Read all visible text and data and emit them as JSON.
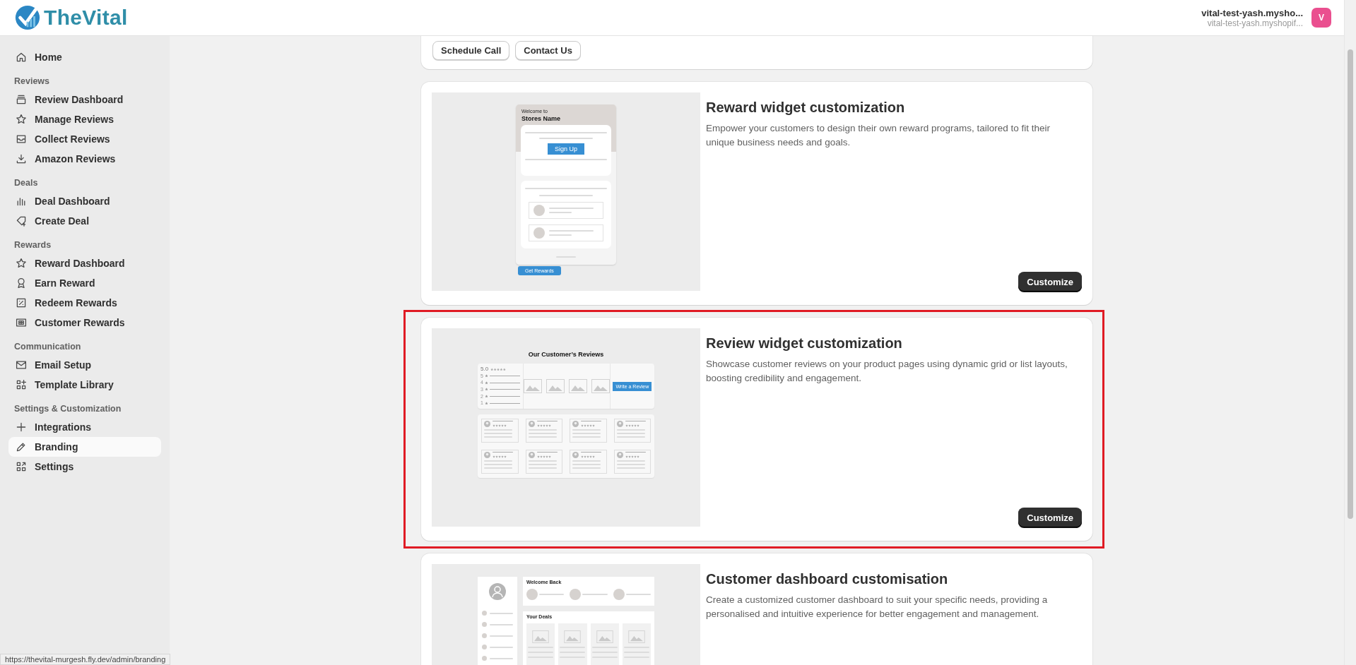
{
  "header": {
    "logo": "TheVital",
    "store_name": "vital-test-yash.mysho...",
    "store_domain": "vital-test-yash.myshopif...",
    "avatar": "V"
  },
  "sidebar": {
    "items": [
      {
        "kind": "link",
        "label": "Home",
        "selected": false
      },
      {
        "kind": "heading",
        "label": "Reviews"
      },
      {
        "kind": "link",
        "label": "Review Dashboard",
        "selected": false
      },
      {
        "kind": "link",
        "label": "Manage Reviews",
        "selected": false
      },
      {
        "kind": "link",
        "label": "Collect Reviews",
        "selected": false
      },
      {
        "kind": "link",
        "label": "Amazon Reviews",
        "selected": false
      },
      {
        "kind": "heading",
        "label": "Deals"
      },
      {
        "kind": "link",
        "label": "Deal Dashboard",
        "selected": false
      },
      {
        "kind": "link",
        "label": "Create Deal",
        "selected": false
      },
      {
        "kind": "heading",
        "label": "Rewards"
      },
      {
        "kind": "link",
        "label": "Reward Dashboard",
        "selected": false
      },
      {
        "kind": "link",
        "label": "Earn Reward",
        "selected": false
      },
      {
        "kind": "link",
        "label": "Redeem Rewards",
        "selected": false
      },
      {
        "kind": "link",
        "label": "Customer Rewards",
        "selected": false
      },
      {
        "kind": "heading",
        "label": "Communication"
      },
      {
        "kind": "link",
        "label": "Email Setup",
        "selected": false
      },
      {
        "kind": "link",
        "label": "Template Library",
        "selected": false
      },
      {
        "kind": "heading",
        "label": "Settings & Customization"
      },
      {
        "kind": "link",
        "label": "Integrations",
        "selected": false
      },
      {
        "kind": "link",
        "label": "Branding",
        "selected": true
      },
      {
        "kind": "link",
        "label": "Settings",
        "selected": false
      }
    ]
  },
  "cards": [
    {
      "kind": "contact",
      "buttons": [
        "Schedule Call",
        "Contact Us"
      ]
    },
    {
      "kind": "reward",
      "title": "Reward widget customization",
      "description": "Empower your customers to design their own reward programs, tailored to fit their unique business needs and goals.",
      "button": "Customize",
      "highlighted": false,
      "preview": {
        "greeting": "Welcome to",
        "store": "Stores Name",
        "signup": "Sign Up",
        "launcher": "Get Rewards"
      }
    },
    {
      "kind": "reviews",
      "title": "Review widget customization",
      "description": "Showcase customer reviews on your product pages using dynamic grid or list layouts, boosting credibility and engagement.",
      "button": "Customize",
      "highlighted": true,
      "preview": {
        "heading": "Our Customer’s Reviews",
        "rating": "5.0",
        "levels": [
          "5",
          "4",
          "3",
          "2",
          "1"
        ],
        "write": "Write a Review"
      }
    },
    {
      "kind": "dashboard",
      "title": "Customer dashboard customisation",
      "description": "Create a customized customer dashboard to suit your specific needs, providing a personalised and intuitive experience for better engagement and management.",
      "highlighted": false,
      "preview": {
        "welcome": "Welcome Back",
        "deals": "Your Deals"
      }
    }
  ],
  "status_bar": "https://thevital-murgesh.fly.dev/admin/branding"
}
